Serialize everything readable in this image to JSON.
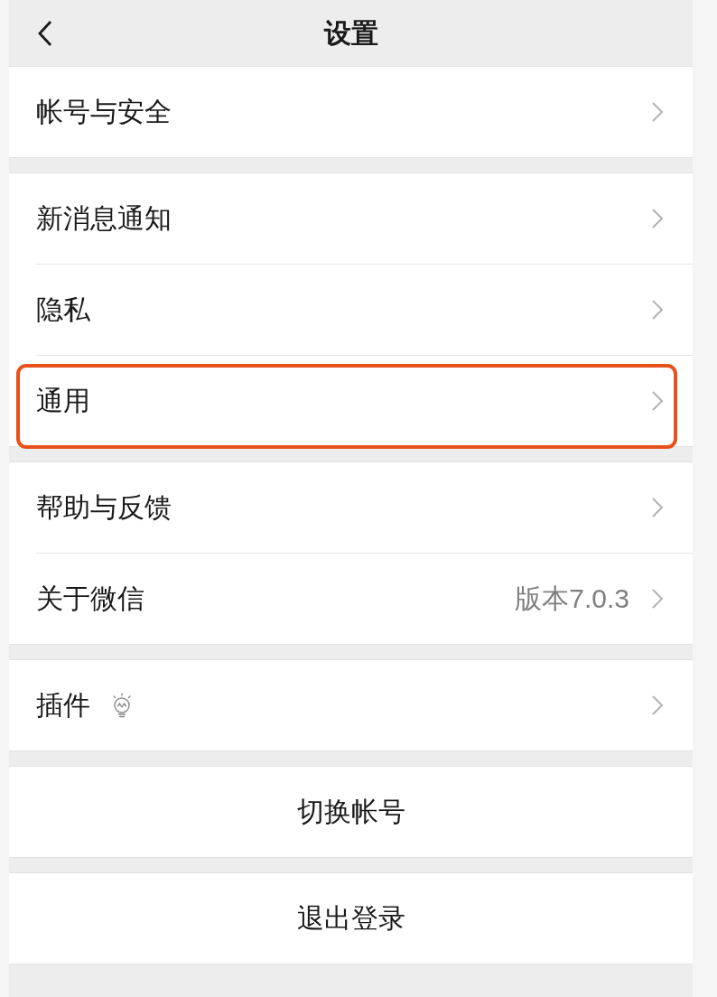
{
  "nav_bar": {
    "title": "设置"
  },
  "groups": [
    {
      "rows": [
        {
          "kind": "link",
          "label": "帐号与安全",
          "has_icon": false,
          "highlighted": false
        }
      ]
    },
    {
      "rows": [
        {
          "kind": "link",
          "label": "新消息通知",
          "has_icon": false,
          "highlighted": false
        },
        {
          "kind": "link",
          "label": "隐私",
          "has_icon": false,
          "highlighted": false
        },
        {
          "kind": "link",
          "label": "通用",
          "has_icon": false,
          "highlighted": true
        }
      ]
    },
    {
      "rows": [
        {
          "kind": "link",
          "label": "帮助与反馈",
          "has_icon": false,
          "highlighted": false
        },
        {
          "kind": "link",
          "label": "关于微信",
          "value": "版本7.0.3",
          "has_icon": false,
          "highlighted": false
        }
      ]
    },
    {
      "rows": [
        {
          "kind": "link",
          "label": "插件",
          "has_icon": true,
          "highlighted": false
        }
      ]
    },
    {
      "rows": [
        {
          "kind": "action",
          "label": "切换帐号",
          "highlighted": false
        }
      ]
    },
    {
      "rows": [
        {
          "kind": "action",
          "label": "退出登录",
          "highlighted": false
        }
      ]
    }
  ]
}
